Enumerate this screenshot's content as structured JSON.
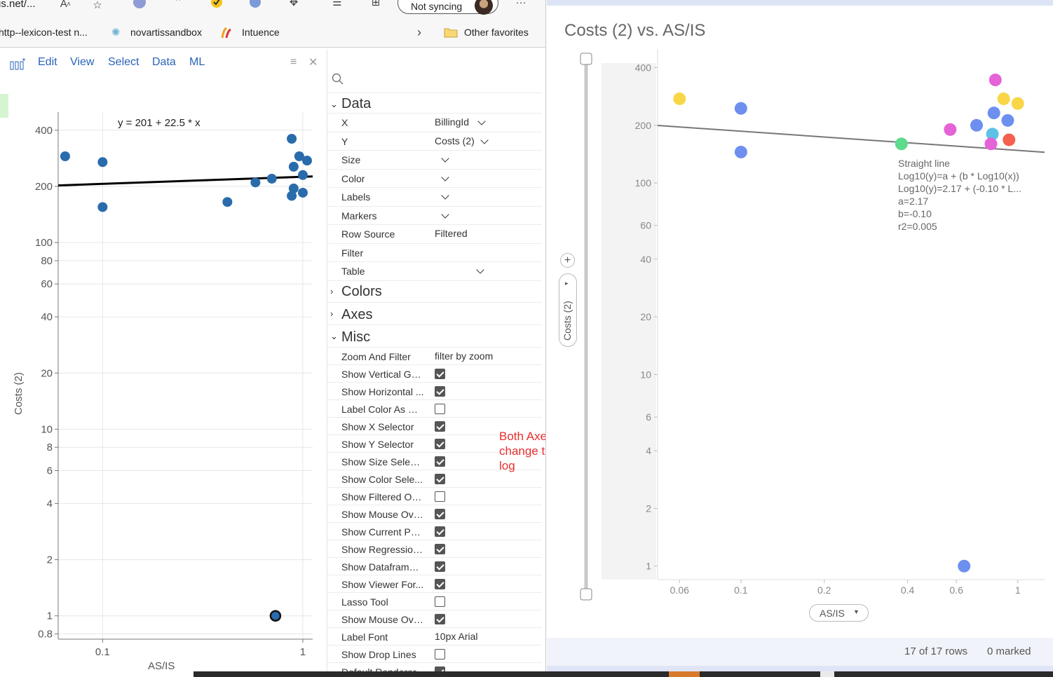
{
  "browser": {
    "url_fragment": "is.net/...",
    "sync_label": "Not syncing",
    "more_icon": "ellipsis-icon",
    "favorites": [
      {
        "label": "http--lexicon-test n..."
      },
      {
        "label": "novartissandbox"
      },
      {
        "label": "Intuence"
      }
    ],
    "other_favorites": "Other favorites"
  },
  "app_menu": {
    "items": [
      "Edit",
      "View",
      "Select",
      "Data",
      "ML"
    ]
  },
  "left_plot": {
    "equation": "y = 201  + 22.5 * x",
    "ylabel": "Costs (2)",
    "xlabel": "AS/IS"
  },
  "props": {
    "sections": {
      "data": "Data",
      "colors": "Colors",
      "axes": "Axes",
      "misc": "Misc"
    },
    "data_rows": [
      {
        "label": "X",
        "value": "BillingId"
      },
      {
        "label": "Y",
        "value": "Costs (2)"
      },
      {
        "label": "Size",
        "value": ""
      },
      {
        "label": "Color",
        "value": ""
      },
      {
        "label": "Labels",
        "value": ""
      },
      {
        "label": "Markers",
        "value": ""
      },
      {
        "label": "Row Source",
        "value": "Filtered"
      },
      {
        "label": "Filter",
        "value": ""
      },
      {
        "label": "Table",
        "value": ""
      }
    ],
    "misc_rows": [
      {
        "label": "Zoom And Filter",
        "value": "filter by zoom",
        "check": null
      },
      {
        "label": "Show Vertical Gri...",
        "value": "",
        "check": true
      },
      {
        "label": "Show Horizontal ...",
        "value": "",
        "check": true
      },
      {
        "label": "Label Color As M...",
        "value": "",
        "check": false
      },
      {
        "label": "Show X Selector",
        "value": "",
        "check": true
      },
      {
        "label": "Show Y Selector",
        "value": "",
        "check": true
      },
      {
        "label": "Show Size Select...",
        "value": "",
        "check": true
      },
      {
        "label": "Show Color Sele...",
        "value": "",
        "check": true
      },
      {
        "label": "Show Filtered Ou...",
        "value": "",
        "check": false
      },
      {
        "label": "Show Mouse Ove...",
        "value": "",
        "check": true
      },
      {
        "label": "Show Current Poi...",
        "value": "",
        "check": true
      },
      {
        "label": "Show Regression...",
        "value": "",
        "check": true
      },
      {
        "label": "Show Dataframe ...",
        "value": "",
        "check": true
      },
      {
        "label": "Show Viewer For...",
        "value": "",
        "check": true
      },
      {
        "label": "Lasso Tool",
        "value": "",
        "check": false
      },
      {
        "label": "Show Mouse Ove...",
        "value": "",
        "check": true
      },
      {
        "label": "Label Font",
        "value": "10px Arial",
        "check": null
      },
      {
        "label": "Show Drop Lines",
        "value": "",
        "check": false
      },
      {
        "label": "Default Renderer",
        "value": "",
        "check": true
      }
    ]
  },
  "note": "Both Axes change to log",
  "right": {
    "title": "Costs (2) vs. AS/IS",
    "y_selector": "Costs (2)",
    "x_selector": "AS/IS",
    "regression": {
      "lines": [
        "Straight line",
        "Log10(y)=a + (b * Log10(x))",
        "Log10(y)=2.17 + (-0.10 * L...",
        "a=2.17",
        "b=-0.10",
        "r2=0.005"
      ]
    },
    "rows_count": "17 of 17 rows",
    "marked_count": "0 marked"
  },
  "chart_data": [
    {
      "type": "scatter",
      "name": "left",
      "xscale": "log",
      "yscale": "log",
      "xlim": [
        0.06,
        1.12
      ],
      "ylim": [
        0.75,
        500
      ],
      "xticks": [
        0.1,
        1
      ],
      "yticks": [
        0.8,
        1,
        2,
        4,
        6,
        8,
        10,
        20,
        40,
        60,
        80,
        100,
        200,
        400
      ],
      "xlabel": "AS/IS",
      "ylabel": "Costs (2)",
      "points": [
        {
          "x": 0.065,
          "y": 290
        },
        {
          "x": 0.1,
          "y": 270
        },
        {
          "x": 0.1,
          "y": 155
        },
        {
          "x": 0.42,
          "y": 165
        },
        {
          "x": 0.58,
          "y": 210
        },
        {
          "x": 0.7,
          "y": 220
        },
        {
          "x": 0.88,
          "y": 360
        },
        {
          "x": 0.96,
          "y": 290
        },
        {
          "x": 1.05,
          "y": 275
        },
        {
          "x": 0.9,
          "y": 255
        },
        {
          "x": 1.0,
          "y": 230
        },
        {
          "x": 0.9,
          "y": 195
        },
        {
          "x": 1.0,
          "y": 185
        },
        {
          "x": 0.88,
          "y": 178
        },
        {
          "x": 0.73,
          "y": 1.0
        }
      ],
      "selected_point": {
        "x": 0.73,
        "y": 1.0
      },
      "point_color": "#2a6cab",
      "regression": {
        "a": 201,
        "b": 22.5
      }
    },
    {
      "type": "scatter",
      "name": "right",
      "xscale": "log",
      "yscale": "log",
      "xlim": [
        0.05,
        1.25
      ],
      "ylim": [
        0.85,
        500
      ],
      "xticks": [
        0.06,
        0.1,
        0.2,
        0.4,
        0.6,
        1
      ],
      "yticks": [
        1,
        2,
        4,
        6,
        10,
        20,
        40,
        60,
        100,
        200,
        400
      ],
      "xlabel": "AS/IS",
      "ylabel": "Costs (2)",
      "points": [
        {
          "x": 0.06,
          "y": 275,
          "color": "#f9d648"
        },
        {
          "x": 0.1,
          "y": 245,
          "color": "#6d8ff0"
        },
        {
          "x": 0.1,
          "y": 145,
          "color": "#6d8ff0"
        },
        {
          "x": 0.38,
          "y": 160,
          "color": "#5edb8c"
        },
        {
          "x": 0.57,
          "y": 190,
          "color": "#e563d6"
        },
        {
          "x": 0.71,
          "y": 200,
          "color": "#6d8ff0"
        },
        {
          "x": 0.83,
          "y": 345,
          "color": "#e563d6"
        },
        {
          "x": 0.89,
          "y": 275,
          "color": "#f9d648"
        },
        {
          "x": 1.0,
          "y": 260,
          "color": "#f9d648"
        },
        {
          "x": 0.82,
          "y": 232,
          "color": "#6d8ff0"
        },
        {
          "x": 0.92,
          "y": 212,
          "color": "#6d8ff0"
        },
        {
          "x": 0.81,
          "y": 180,
          "color": "#5ec2e8"
        },
        {
          "x": 0.8,
          "y": 160,
          "color": "#e563d6"
        },
        {
          "x": 0.93,
          "y": 168,
          "color": "#f4624f"
        },
        {
          "x": 0.64,
          "y": 1.0,
          "color": "#6d8ff0"
        }
      ],
      "regression": {
        "a": 2.17,
        "b": -0.1
      }
    }
  ]
}
